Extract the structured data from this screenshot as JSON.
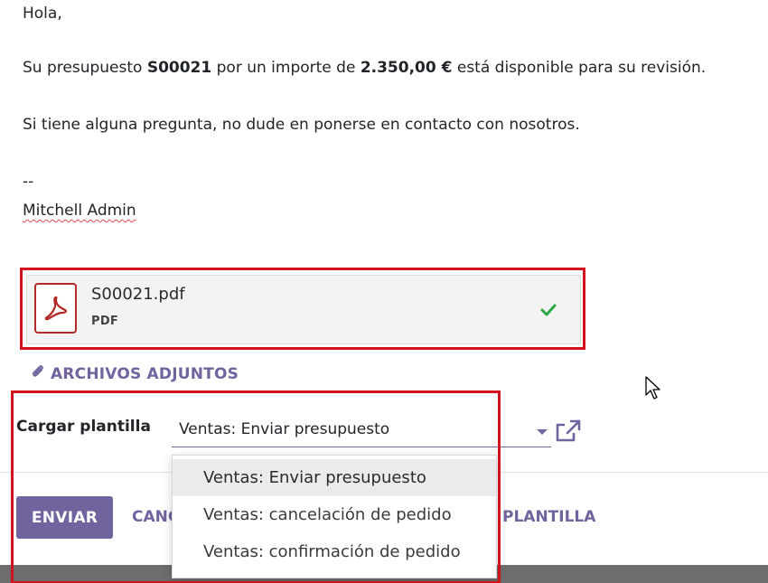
{
  "email": {
    "greeting": "Hola,",
    "line2_prefix": "Su presupuesto ",
    "quote_ref": "S00021",
    "line2_middle": " por un importe de ",
    "amount": "2.350,00 €",
    "line2_suffix": " está disponible para su revisión.",
    "line3": "Si tiene alguna pregunta, no dude en ponerse en contacto con nosotros.",
    "signature_sep": "--",
    "signature_name": "Mitchell Admin"
  },
  "attachment": {
    "file_name": "S00021.pdf",
    "file_type": "PDF",
    "icon": "pdf-icon",
    "status_icon": "check-icon"
  },
  "attachments_link": {
    "label": "ARCHIVOS ADJUNTOS",
    "icon": "paperclip-icon"
  },
  "template": {
    "label": "Cargar plantilla",
    "selected": "Ventas: Enviar presupuesto",
    "options": [
      "Ventas: Enviar presupuesto",
      "Ventas: cancelación de pedido",
      "Ventas: confirmación de pedido"
    ],
    "active_index": 0
  },
  "footer": {
    "send_label": "ENVIAR",
    "cancel_label": "CANCELAR",
    "save_template_label": "GUARDAR COMO NUEVA PLANTILLA",
    "save_template_visible": "PLANTILLA"
  },
  "colors": {
    "accent": "#71639e",
    "highlight": "#d0131d",
    "pdf": "#b22a27",
    "success": "#28a745"
  }
}
